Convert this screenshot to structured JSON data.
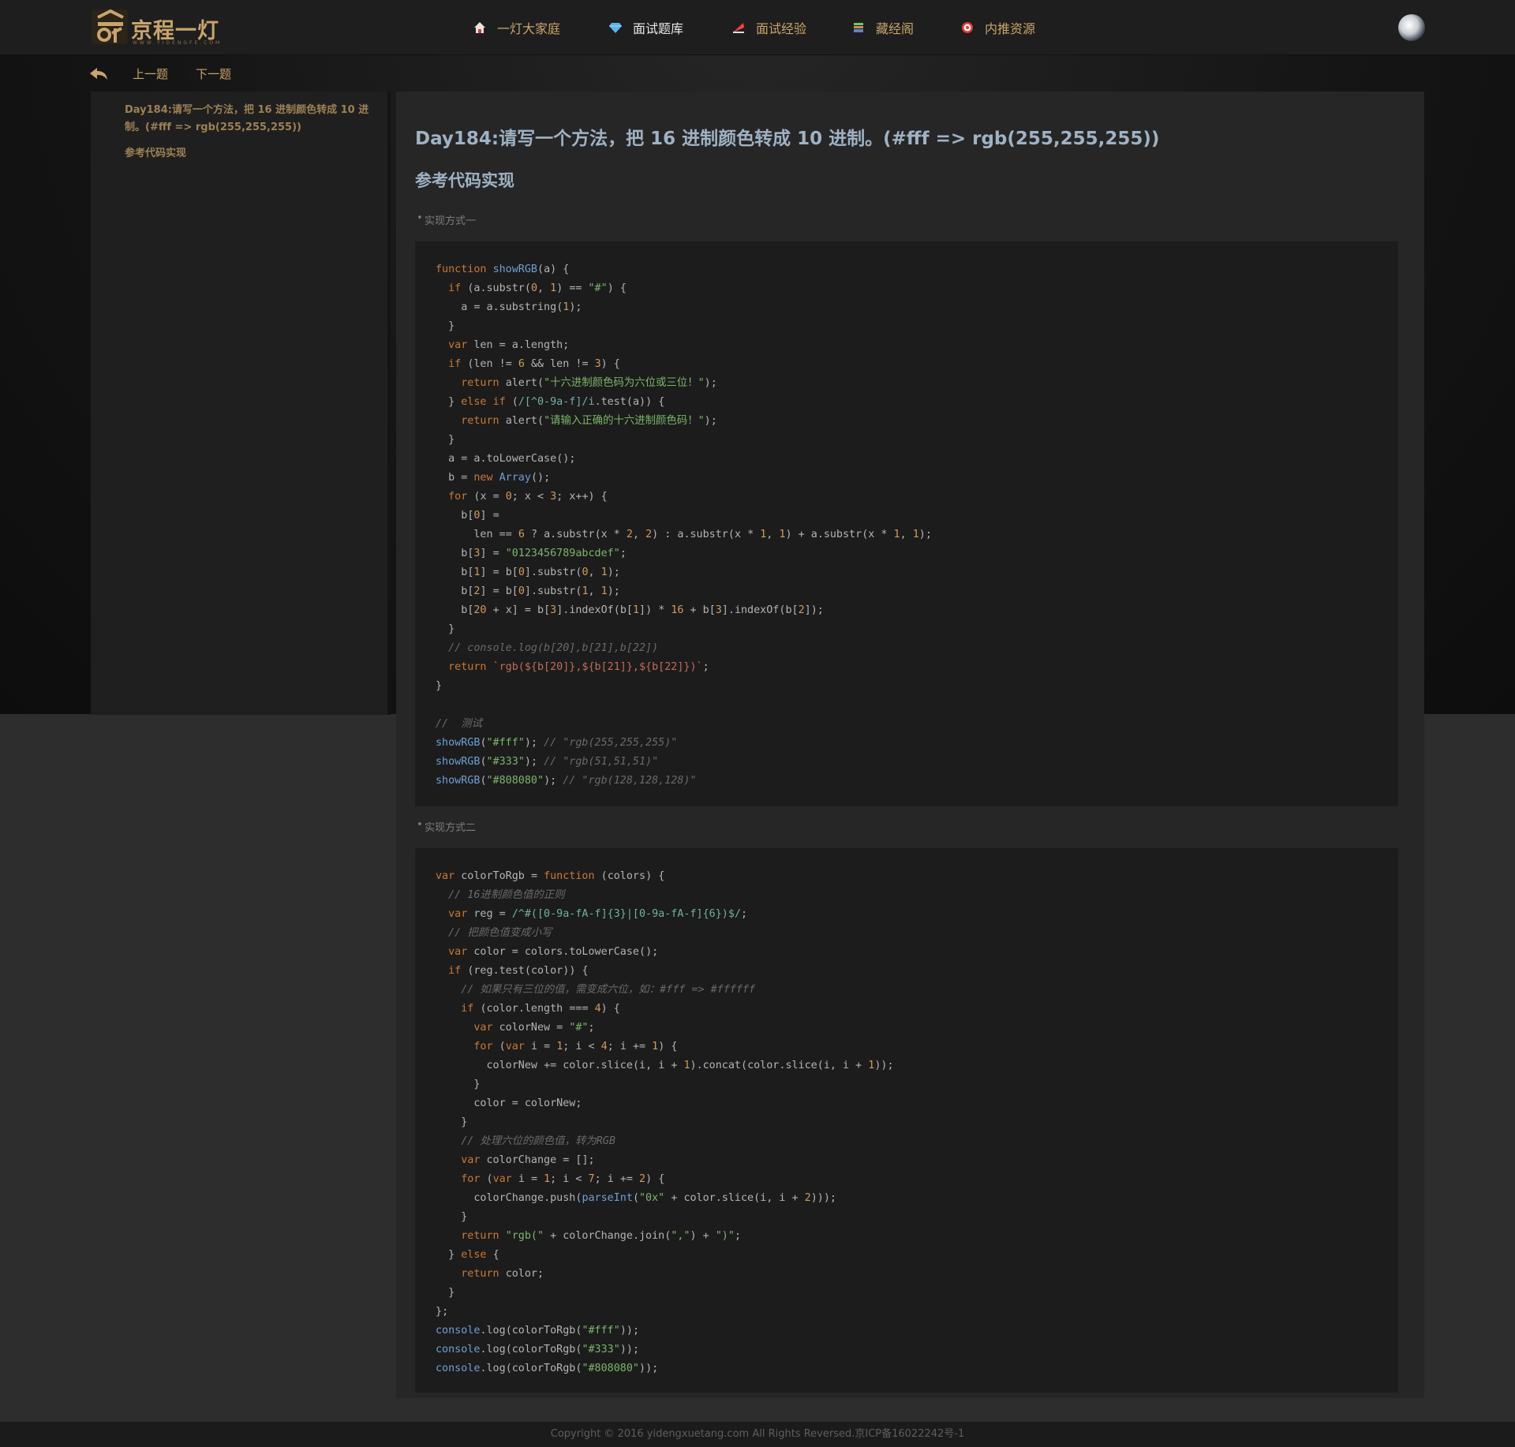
{
  "header": {
    "logo_text": "京程一灯",
    "logo_sub": "WWW.YIDENGFE.COM",
    "nav": [
      {
        "label": "一灯大家庭",
        "icon": "home-icon"
      },
      {
        "label": "面试题库",
        "icon": "diamond-icon"
      },
      {
        "label": "面试经验",
        "icon": "feather-icon"
      },
      {
        "label": "藏经阁",
        "icon": "books-icon"
      },
      {
        "label": "内推资源",
        "icon": "target-icon"
      }
    ]
  },
  "subnav": {
    "prev": "上一题",
    "next": "下一题"
  },
  "sidebar": {
    "toc_title": "Day184:请写一个方法，把 16 进制颜色转成 10 进制。(#fff => rgb(255,255,255))",
    "toc_sub": "参考代码实现"
  },
  "main": {
    "title": "Day184:请写一个方法，把 16 进制颜色转成 10 进制。(#fff => rgb(255,255,255))",
    "h2": "参考代码实现",
    "method1": "实现方式一",
    "method2": "实现方式二"
  },
  "code1": [
    "function showRGB(a) {",
    "  if (a.substr(0, 1) == \"#\") {",
    "    a = a.substring(1);",
    "  }",
    "  var len = a.length;",
    "  if (len != 6 && len != 3) {",
    "    return alert(\"十六进制颜色码为六位或三位！\");",
    "  } else if (/[^0-9a-f]/i.test(a)) {",
    "    return alert(\"请输入正确的十六进制颜色码！\");",
    "  }",
    "  a = a.toLowerCase();",
    "  b = new Array();",
    "  for (x = 0; x < 3; x++) {",
    "    b[0] =",
    "      len == 6 ? a.substr(x * 2, 2) : a.substr(x * 1, 1) + a.substr(x * 1, 1);",
    "    b[3] = \"0123456789abcdef\";",
    "    b[1] = b[0].substr(0, 1);",
    "    b[2] = b[0].substr(1, 1);",
    "    b[20 + x] = b[3].indexOf(b[1]) * 16 + b[3].indexOf(b[2]);",
    "  }",
    "  // console.log(b[20],b[21],b[22])",
    "  return `rgb(${b[20]},${b[21]},${b[22]})`;",
    "}",
    "",
    "//  测试",
    "showRGB(\"#fff\"); // \"rgb(255,255,255)\"",
    "showRGB(\"#333\"); // \"rgb(51,51,51)\"",
    "showRGB(\"#808080\"); // \"rgb(128,128,128)\""
  ],
  "code2": [
    "var colorToRgb = function (colors) {",
    "  // 16进制颜色值的正则",
    "  var reg = /^#([0-9a-fA-f]{3}|[0-9a-fA-f]{6})$/;",
    "  // 把颜色值变成小写",
    "  var color = colors.toLowerCase();",
    "  if (reg.test(color)) {",
    "    // 如果只有三位的值，需变成六位，如：#fff => #ffffff",
    "    if (color.length === 4) {",
    "      var colorNew = \"#\";",
    "      for (var i = 1; i < 4; i += 1) {",
    "        colorNew += color.slice(i, i + 1).concat(color.slice(i, i + 1));",
    "      }",
    "      color = colorNew;",
    "    }",
    "    // 处理六位的颜色值，转为RGB",
    "    var colorChange = [];",
    "    for (var i = 1; i < 7; i += 2) {",
    "      colorChange.push(parseInt(\"0x\" + color.slice(i, i + 2)));",
    "    }",
    "    return \"rgb(\" + colorChange.join(\",\") + \")\";",
    "  } else {",
    "    return color;",
    "  }",
    "};",
    "console.log(colorToRgb(\"#fff\"));",
    "console.log(colorToRgb(\"#333\"));",
    "console.log(colorToRgb(\"#808080\"));"
  ],
  "footer": {
    "copyright": "Copyright © 2016 yidengxuetang.com All Rights Reversed.京ICP备16022242号-1"
  }
}
